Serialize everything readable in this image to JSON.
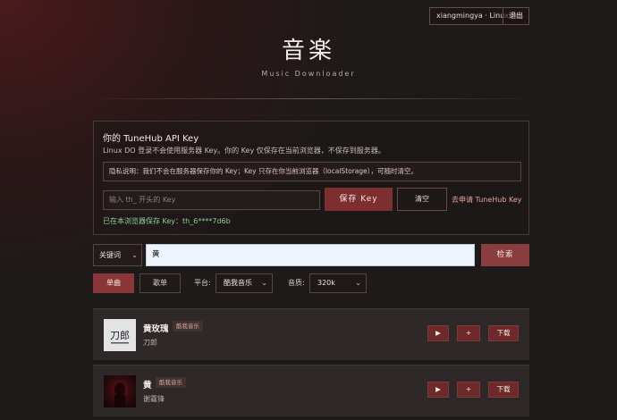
{
  "header": {
    "user_label": "xiangmingya · Linux DO",
    "logout_label": "退出",
    "title": "音楽",
    "subtitle": "Music Downloader"
  },
  "api_key": {
    "title": "你的 TuneHub API Key",
    "description": "Linux DO 登录不会使用服务器 Key。你的 Key 仅保存在当前浏览器，不保存到服务器。",
    "privacy_note": "隐私说明：我们不会在服务器保存你的 Key；Key 只存在你当前浏览器（localStorage），可随时清空。",
    "input_placeholder": "输入 th_ 开头的 Key",
    "save_label": "保存 Key",
    "clear_label": "清空",
    "apply_link": "去申请 TuneHub Key",
    "status": "已在本浏览器保存 Key：th_6****7d6b"
  },
  "search": {
    "type_selected": "关键词",
    "query": "黄",
    "button_label": "检索"
  },
  "filters": {
    "tab_single": "单曲",
    "tab_playlist": "歌单",
    "platform_label": "平台:",
    "platform_selected": "酷我音乐",
    "quality_label": "音质:",
    "quality_selected": "320k"
  },
  "results": [
    {
      "title": "黄玫瑰",
      "source": "酷我音乐",
      "artist": "刀郎",
      "cover_text": "刀郎",
      "play": "▶",
      "add": "+",
      "download": "下载"
    },
    {
      "title": "黄",
      "source": "酷我音乐",
      "artist": "谢霆锋",
      "cover_text": "",
      "play": "▶",
      "add": "+",
      "download": "下载"
    }
  ],
  "colors": {
    "accent": "#8a3d3d",
    "success": "#8ed08a"
  },
  "icons": {
    "chevron": "chevron-down-icon",
    "play": "play-icon",
    "add": "plus-icon"
  }
}
